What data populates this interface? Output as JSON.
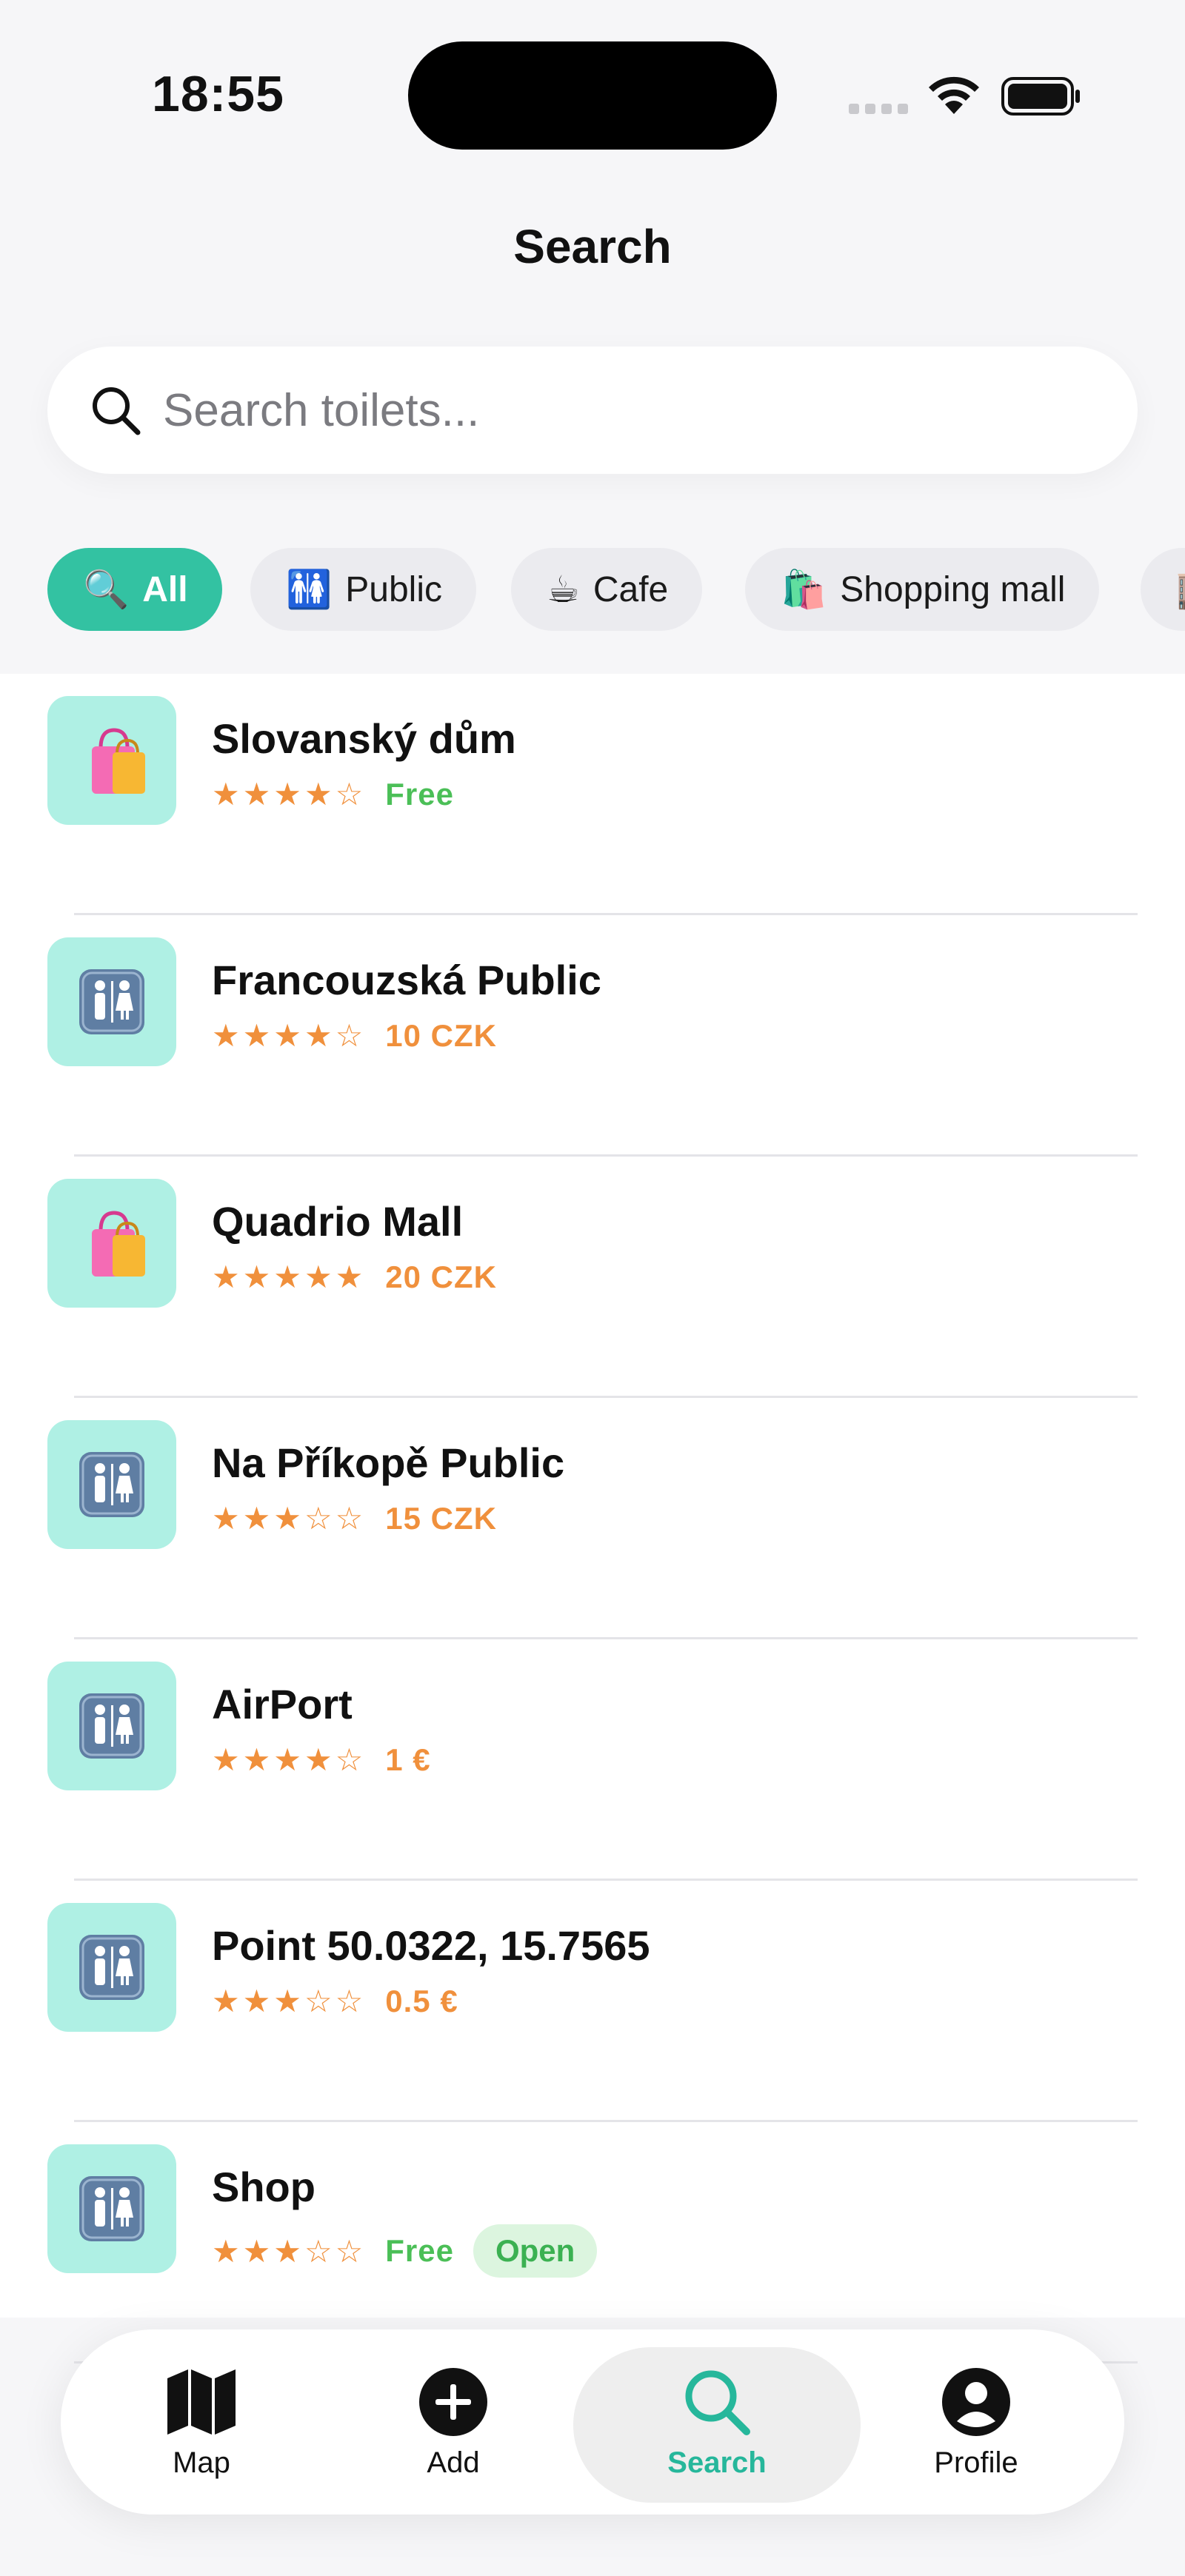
{
  "status_bar": {
    "time": "18:55"
  },
  "header": {
    "title": "Search"
  },
  "search": {
    "placeholder": "Search toilets...",
    "value": ""
  },
  "filters": [
    {
      "emoji": "🔍",
      "label": "All",
      "active": true
    },
    {
      "emoji": "🚻",
      "label": "Public",
      "active": false
    },
    {
      "emoji": "☕",
      "label": "Cafe",
      "active": false
    },
    {
      "emoji": "🛍️",
      "label": "Shopping mall",
      "active": false
    },
    {
      "emoji": "🏬",
      "label": "",
      "active": false
    }
  ],
  "results": [
    {
      "name": "Slovanský dům",
      "icon": "shopping-bags-icon",
      "stars": "★★★★☆",
      "rating": 4,
      "price": "Free",
      "price_free": true,
      "badge": ""
    },
    {
      "name": "Francouzská Public",
      "icon": "restroom-icon",
      "stars": "★★★★☆",
      "rating": 4,
      "price": "10 CZK",
      "price_free": false,
      "badge": ""
    },
    {
      "name": "Quadrio Mall",
      "icon": "shopping-bags-icon",
      "stars": "★★★★★",
      "rating": 5,
      "price": "20 CZK",
      "price_free": false,
      "badge": ""
    },
    {
      "name": "Na Příkopě Public",
      "icon": "restroom-icon",
      "stars": "★★★☆☆",
      "rating": 3,
      "price": "15 CZK",
      "price_free": false,
      "badge": ""
    },
    {
      "name": "AirPort",
      "icon": "restroom-icon",
      "stars": "★★★★☆",
      "rating": 4,
      "price": "1 €",
      "price_free": false,
      "badge": ""
    },
    {
      "name": "Point 50.0322, 15.7565",
      "icon": "restroom-icon",
      "stars": "★★★☆☆",
      "rating": 3,
      "price": "0.5 €",
      "price_free": false,
      "badge": ""
    },
    {
      "name": "Shop",
      "icon": "restroom-icon",
      "stars": "★★★☆☆",
      "rating": 3,
      "price": "Free",
      "price_free": true,
      "badge": "Open"
    }
  ],
  "tabbar": {
    "map": "Map",
    "add": "Add",
    "search": "Search",
    "profile": "Profile",
    "selected": "search"
  },
  "colors": {
    "accent": "#33c2a2",
    "tab_selected": "#26b79b",
    "icon_tile": "#aff0e4",
    "star": "#f0903c",
    "free": "#4bbf57",
    "open_badge_bg": "#dcf5df"
  }
}
